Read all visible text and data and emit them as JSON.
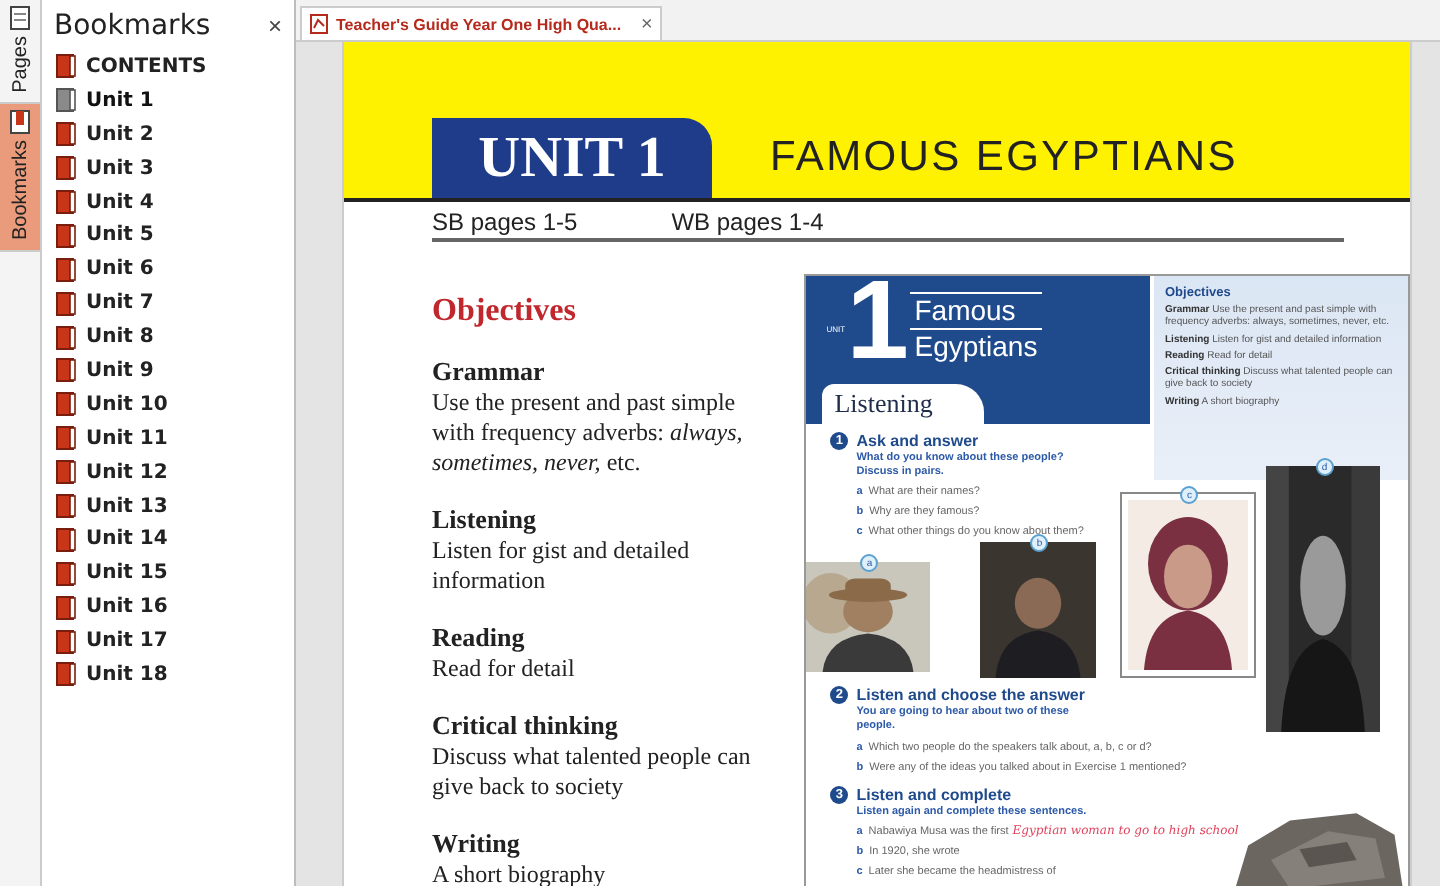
{
  "side_tabs": [
    {
      "label": "Pages",
      "kind": "pages",
      "selected": false
    },
    {
      "label": "Bookmarks",
      "kind": "bookmarks",
      "selected": true
    }
  ],
  "bookmarks_panel": {
    "title": "Bookmarks",
    "close": "×",
    "items": [
      {
        "label": "CONTENTS",
        "selected": false
      },
      {
        "label": "Unit 1",
        "selected": true
      },
      {
        "label": "Unit 2",
        "selected": false
      },
      {
        "label": "Unit 3",
        "selected": false
      },
      {
        "label": "Unit 4",
        "selected": false
      },
      {
        "label": "Unit 5",
        "selected": false
      },
      {
        "label": "Unit 6",
        "selected": false
      },
      {
        "label": "Unit 7",
        "selected": false
      },
      {
        "label": "Unit 8",
        "selected": false
      },
      {
        "label": "Unit 9",
        "selected": false
      },
      {
        "label": "Unit 10",
        "selected": false
      },
      {
        "label": "Unit 11",
        "selected": false
      },
      {
        "label": "Unit 12",
        "selected": false
      },
      {
        "label": "Unit 13",
        "selected": false
      },
      {
        "label": "Unit 14",
        "selected": false
      },
      {
        "label": "Unit 15",
        "selected": false
      },
      {
        "label": "Unit 16",
        "selected": false
      },
      {
        "label": "Unit 17",
        "selected": false
      },
      {
        "label": "Unit 18",
        "selected": false
      }
    ]
  },
  "doc_tabs": [
    {
      "title": "Teacher's Guide Year One High Qua...",
      "close": "×",
      "selected": true
    }
  ],
  "page": {
    "unit": "UNIT 1",
    "unit_title": "FAMOUS EGYPTIANS",
    "refs": [
      "SB pages 1-5",
      "WB pages 1-4"
    ],
    "objectives_heading": "Objectives",
    "objectives": [
      {
        "heading": "Grammar",
        "text": "Use the present and past simple with frequency adverbs: *always, sometimes, never,* etc."
      },
      {
        "heading": "Listening",
        "text": "Listen for gist and detailed information"
      },
      {
        "heading": "Reading",
        "text": "Read for detail"
      },
      {
        "heading": "Critical thinking",
        "text": "Discuss what talented people can give back to society"
      },
      {
        "heading": "Writing",
        "text": "A short biography"
      }
    ],
    "inset": {
      "unit_label": "UNIT",
      "unit_number": "1",
      "title_lines": [
        "Famous",
        "Egyptians"
      ],
      "section_tab": "Listening",
      "objectives_heading": "Objectives",
      "objectives": [
        "**Grammar** Use the present and past simple with frequency adverbs: always, sometimes, never, etc.",
        "**Listening** Listen for gist and detailed information",
        "**Reading** Read for detail",
        "**Critical thinking** Discuss what talented people can give back to society",
        "**Writing** A short biography"
      ],
      "exercises": [
        {
          "number": "1",
          "title": "Ask and answer",
          "instruction": "What do you know about these people? Discuss in pairs.",
          "items": [
            {
              "letter": "a",
              "text": "What are their names?"
            },
            {
              "letter": "b",
              "text": "Why are they famous?"
            },
            {
              "letter": "c",
              "text": "What other things do you know about them?"
            }
          ]
        },
        {
          "number": "2",
          "title": "Listen and choose the answer",
          "instruction": "You are going to hear about two of these people.",
          "items": [
            {
              "letter": "a",
              "text": "Which two people do the speakers talk about, a, b, c or d?"
            },
            {
              "letter": "b",
              "text": "Were any of the ideas you talked about in Exercise 1 mentioned?"
            }
          ]
        },
        {
          "number": "3",
          "title": "Listen and complete",
          "instruction": "Listen again and complete these sentences.",
          "items": [
            {
              "letter": "a",
              "text": "Nabawiya Musa was the first",
              "answer": "Egyptian woman to go to high school"
            },
            {
              "letter": "b",
              "text": "In 1920, she wrote"
            },
            {
              "letter": "c",
              "text": "Later she became the headmistress of"
            }
          ]
        }
      ],
      "photos": [
        {
          "label": "a",
          "kind": "picture"
        },
        {
          "label": "b",
          "kind": "picture"
        },
        {
          "label": "c",
          "kind": "picture"
        },
        {
          "label": "d",
          "kind": "picture"
        }
      ],
      "extra_picture": {
        "kind": "picture"
      }
    }
  }
}
